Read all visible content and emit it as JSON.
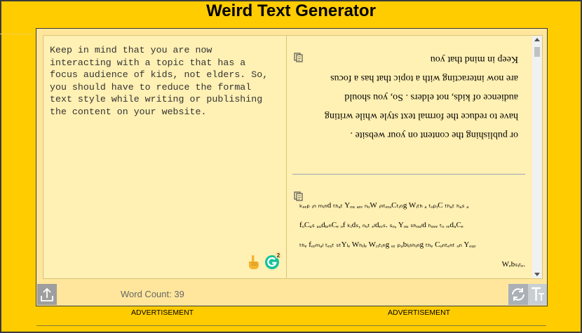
{
  "page_title": "Weird Text Generator",
  "input": {
    "lines": [
      "Keep in mind that you are now",
      "interacting with a topic that has a",
      "focus audience of kids, not elders. So,",
      "you should have to reduce the formal",
      "text style while writing or publishing",
      "the content on your website."
    ]
  },
  "output_flipped": {
    "lines": [
      "Keep in mind that you",
      "are now interacting with a topic that has a focus",
      "audience of kids, not elders . So, you should",
      "have to reduce the formal text style while writing",
      "or publishing the content on your website ."
    ]
  },
  "output_weird": {
    "lines": [
      "ₖₑₑₚ ᵢₙ ₘᵢₙd ₜₕₐₜ Yₒᵤ ₐᵣₑ ₙₒW ᵢₙₜₑᵣₐCₜᵢₙg Wᵢₜₕ ₐ ₜₒₚᵢC ₜₕₐₜ ₕₐₛ ₐ",
      "fₒCᵤₛ ₐᵤdᵢₑₙCₑ ₒf ₖᵢdₛ, ₙₒₜ ₑₗdₑᵣₛ. ₛₒ, Yₒᵤ ₛₕₒᵤₗd ₕₐᵥₑ ₜₒ ᵣₑdᵤCₑ",
      "ₜₕₑ fₒᵣₘₐₗ ₜₑₓₜ ₛₜYₗₑ Wₕᵢₗₑ Wᵣᵢₜᵢₙg ₒᵣ ₚᵤbₗᵢₛₕᵢₙg ₜₕₑ Cₒₙₜₑₙₜ ₒₙ Yₒᵤᵣ",
      "Wₑbₛᵢₜₑ."
    ]
  },
  "word_count": "Word Count: 39",
  "grammarly_badge": "2",
  "ads": {
    "left": "ADVERTISEMENT",
    "right": "ADVERTISEMENT"
  },
  "colors": {
    "background": "#ffcc00",
    "panel": "#ffe69c",
    "textarea": "#fff0b3"
  },
  "icons": {
    "upload": "upload-icon",
    "refresh": "refresh-icon",
    "font": "font-icon",
    "copy": "copy-icon",
    "hand": "hand-icon",
    "grammarly": "grammarly-icon"
  }
}
